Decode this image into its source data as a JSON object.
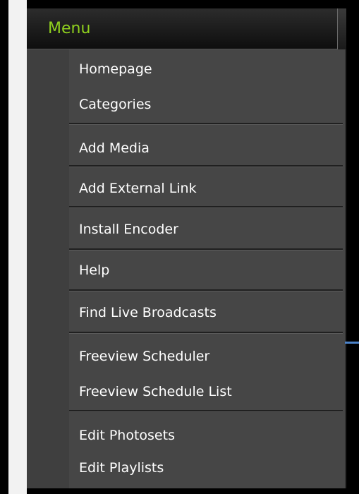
{
  "menu": {
    "title": "Menu",
    "items": [
      {
        "label": "Homepage"
      },
      {
        "label": "Categories"
      },
      {
        "label": "Add Media"
      },
      {
        "label": "Add External Link"
      },
      {
        "label": "Install Encoder"
      },
      {
        "label": "Help"
      },
      {
        "label": "Find Live Broadcasts"
      },
      {
        "label": "Freeview Scheduler"
      },
      {
        "label": "Freeview Schedule List"
      },
      {
        "label": "Edit Photosets"
      },
      {
        "label": "Edit Playlists"
      }
    ]
  },
  "colors": {
    "background": "#000000",
    "panel": "#464646",
    "header_text": "#8fd01e",
    "item_text": "#ffffff",
    "accent_tick": "#4b82c8"
  }
}
